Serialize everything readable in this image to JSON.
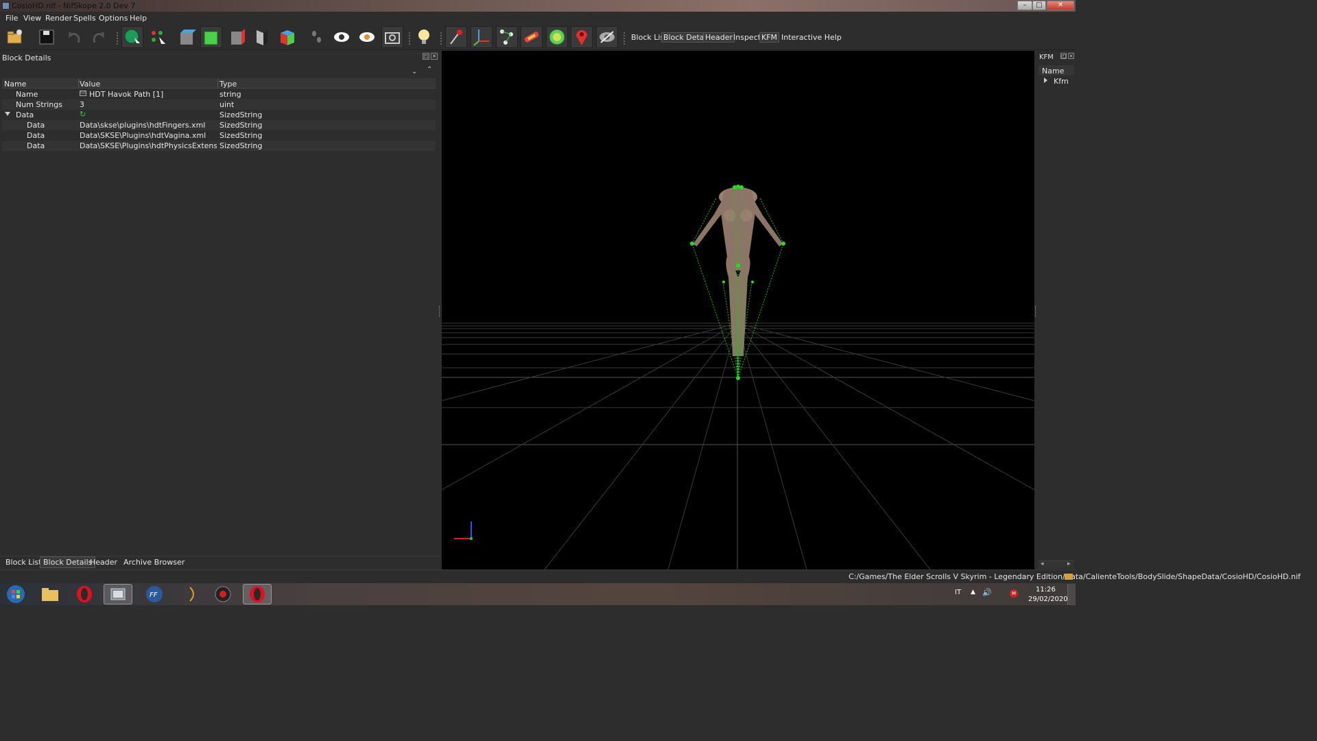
{
  "window": {
    "title": "CosioHD.nif - NifSkope 2.0 Dev 7",
    "btn_min": "–",
    "btn_max": "□",
    "btn_close": "✕"
  },
  "menu": [
    "File",
    "View",
    "Render",
    "Spells",
    "Options",
    "Help"
  ],
  "toolbar_tabs": [
    "Block List",
    "Block Details",
    "Header",
    "Inspect",
    "KFM",
    "Interactive Help"
  ],
  "block_details": {
    "title": "Block Details",
    "columns": [
      "Name",
      "Value",
      "Type"
    ],
    "rows": [
      {
        "name": "Name",
        "value": "HDT Havok Path [1]",
        "type": "string"
      },
      {
        "name": "Num Strings",
        "value": "3",
        "type": "uint"
      },
      {
        "name": "Data",
        "value": "",
        "type": "SizedString"
      },
      {
        "name": "Data",
        "value": "Data\\skse\\plugins\\hdtFingers.xml",
        "type": "SizedString"
      },
      {
        "name": "Data",
        "value": "Data\\SKSE\\Plugins\\hdtVagina.xml",
        "type": "SizedString"
      },
      {
        "name": "Data",
        "value": "Data\\SKSE\\Plugins\\hdtPhysicsExtensionsDef...",
        "type": "SizedString"
      }
    ]
  },
  "bottom_tabs": [
    "Block List",
    "Block Details",
    "Header",
    "Archive Browser"
  ],
  "kfm_panel": {
    "title": "KFM",
    "column": "Name",
    "item": "Kfm"
  },
  "status_path": "C:/Games/The Elder Scrolls V Skyrim - Legendary Edition/Data/CalienteTools/BodySlide/ShapeData/CosioHD/CosioHD.nif",
  "taskbar": {
    "lang": "IT",
    "time": "11:26",
    "date": "29/02/2020"
  },
  "colors": {
    "panel": "#2d2d2d",
    "viewport": "#000000",
    "bone_green": "#22dd22"
  }
}
